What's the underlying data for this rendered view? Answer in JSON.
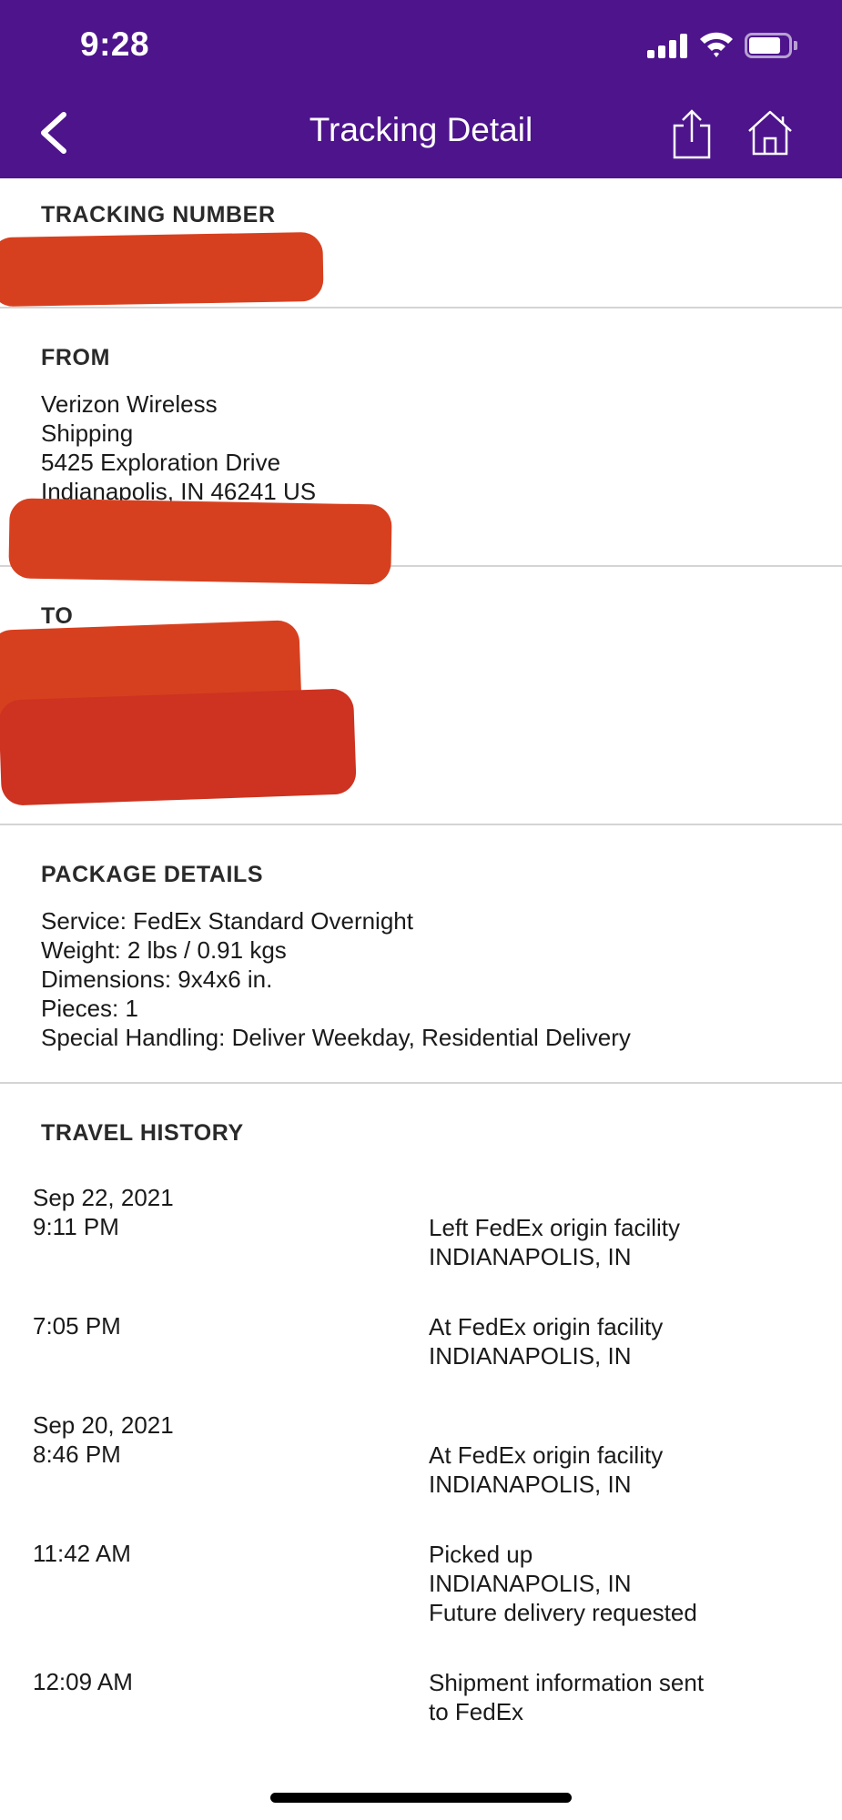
{
  "status_bar": {
    "time": "9:28"
  },
  "nav": {
    "title": "Tracking Detail"
  },
  "tracking": {
    "label": "TRACKING NUMBER"
  },
  "from": {
    "label": "FROM",
    "lines": [
      "Verizon Wireless",
      "Shipping",
      "5425 Exploration Drive",
      "Indianapolis, IN 46241 US"
    ]
  },
  "to": {
    "label": "TO"
  },
  "package": {
    "label": "PACKAGE DETAILS",
    "service": "Service: FedEx Standard Overnight",
    "weight": "Weight: 2 lbs / 0.91 kgs",
    "dimensions": "Dimensions: 9x4x6 in.",
    "pieces": "Pieces: 1",
    "special": "Special Handling: Deliver Weekday, Residential Delivery"
  },
  "history": {
    "label": "TRAVEL HISTORY",
    "events": [
      {
        "date": "Sep 22, 2021",
        "time": "9:11 PM",
        "status": "Left FedEx origin facility",
        "location": "INDIANAPOLIS, IN",
        "note": ""
      },
      {
        "date": "",
        "time": "7:05 PM",
        "status": "At FedEx origin facility",
        "location": "INDIANAPOLIS, IN",
        "note": ""
      },
      {
        "date": "Sep 20, 2021",
        "time": "8:46 PM",
        "status": "At FedEx origin facility",
        "location": "INDIANAPOLIS, IN",
        "note": ""
      },
      {
        "date": "",
        "time": "11:42 AM",
        "status": "Picked up",
        "location": "INDIANAPOLIS, IN",
        "note": "Future delivery requested"
      },
      {
        "date": "",
        "time": "12:09 AM",
        "status": "Shipment information sent",
        "location": "to FedEx",
        "note": ""
      }
    ]
  },
  "colors": {
    "brand_purple": "#4d148c",
    "redaction": "#d7401f",
    "divider": "#d4d4d4"
  },
  "icons": {
    "back": "chevron-left-icon",
    "share": "share-icon",
    "home": "home-icon"
  }
}
